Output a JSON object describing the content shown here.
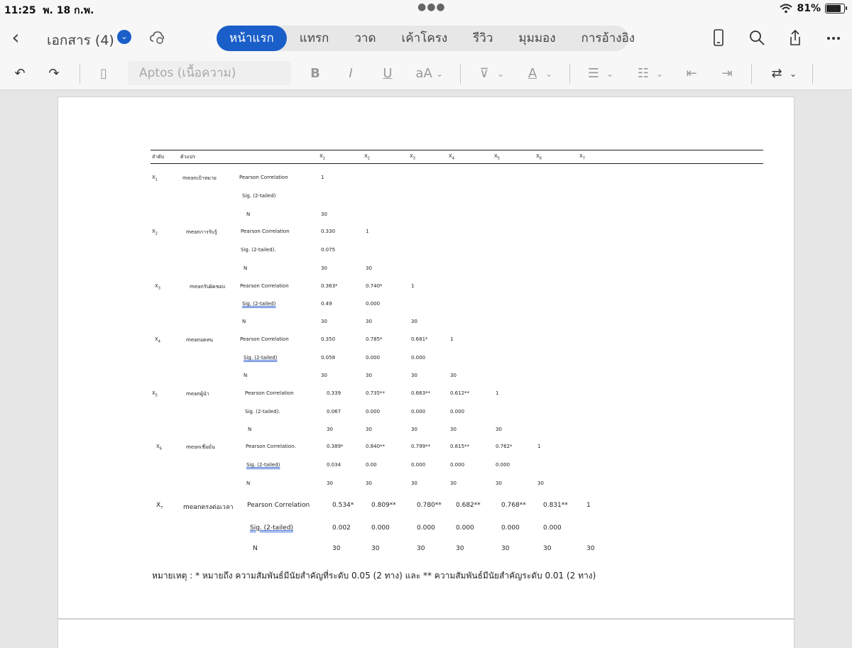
{
  "status": {
    "time": "11:25",
    "date": "พ. 18 ก.พ.",
    "battery": "81%"
  },
  "header": {
    "title": "เอกสาร (4)",
    "tabs": [
      "หน้าแรก",
      "แทรก",
      "วาด",
      "เค้าโครง",
      "รีวิว",
      "มุมมอง",
      "การอ้างอิง"
    ],
    "active_tab": 0
  },
  "toolbar": {
    "font_name": "Aptos (เนื้อความ)",
    "bold": "B",
    "italic": "I",
    "underline": "U",
    "font_size": "aA"
  },
  "table": {
    "headers": {
      "order": "ลำดับ",
      "variable": "ตัวแปร",
      "x1": "X",
      "x2": "X",
      "x3": "X",
      "x4": "X",
      "x5": "X",
      "x6": "X",
      "x7": "X"
    },
    "rows": [
      {
        "id": "X",
        "id_sub": "1",
        "name": "meanเป้าหมาย",
        "stats": [
          {
            "label": "Pearson Correlation",
            "values": [
              "1",
              "",
              "",
              "",
              "",
              "",
              ""
            ]
          },
          {
            "label": "Sig. (2-tailed)",
            "values": [
              "",
              "",
              "",
              "",
              "",
              "",
              ""
            ]
          },
          {
            "label": "N",
            "values": [
              "30",
              "",
              "",
              "",
              "",
              "",
              ""
            ]
          }
        ]
      },
      {
        "id": "X",
        "id_sub": "2",
        "name": "meanการรับรู้",
        "stats": [
          {
            "label": "Pearson Correlation",
            "values": [
              "0.330",
              "1",
              "",
              "",
              "",
              "",
              ""
            ]
          },
          {
            "label": "Sig. (2-tailed).",
            "values": [
              "0.075",
              "",
              "",
              "",
              "",
              "",
              ""
            ]
          },
          {
            "label": "N",
            "values": [
              "30",
              "30",
              "",
              "",
              "",
              "",
              ""
            ]
          }
        ]
      },
      {
        "id": "X",
        "id_sub": "3",
        "name": "meanรับผิดชอบ",
        "stats": [
          {
            "label": "Pearson Correlation",
            "values": [
              "0.363*",
              "0.740*",
              "1",
              "",
              "",
              "",
              ""
            ]
          },
          {
            "label": "Sig. (2-tailed)",
            "values": [
              "0.49",
              "0.000",
              "",
              "",
              "",
              "",
              ""
            ]
          },
          {
            "label": "N",
            "values": [
              "30",
              "30",
              "30",
              "",
              "",
              "",
              ""
            ]
          }
        ]
      },
      {
        "id": "X",
        "id_sub": "4",
        "name": "meanอดทน",
        "stats": [
          {
            "label": "Pearson Correlation",
            "values": [
              "0.350",
              "0.785*",
              "0.681*",
              "1",
              "",
              "",
              ""
            ]
          },
          {
            "label": "Sig. (2-tailed)",
            "values": [
              "0.058",
              "0.000",
              "0.000",
              "",
              "",
              "",
              ""
            ]
          },
          {
            "label": "N",
            "values": [
              "30",
              "30",
              "30",
              "30",
              "",
              "",
              ""
            ]
          }
        ]
      },
      {
        "id": "X",
        "id_sub": "5",
        "name": "meanผู้นำ",
        "stats": [
          {
            "label": "Pearson Correlation",
            "values": [
              "0.339",
              "0.735**",
              "0.663**",
              "0.612**",
              "1",
              "",
              ""
            ]
          },
          {
            "label": "Sig. (2-tailed).",
            "values": [
              "0.067",
              "0.000",
              "0.000",
              "0.000",
              "",
              "",
              ""
            ]
          },
          {
            "label": "N",
            "values": [
              "30",
              "30",
              "30",
              "30",
              "30",
              "",
              ""
            ]
          }
        ]
      },
      {
        "id": "X",
        "id_sub": "6",
        "name": "meanเชื่อมั่น",
        "stats": [
          {
            "label": "Pearson Correlation.",
            "values": [
              "0.389*",
              "0.840**",
              "0.799**",
              "0.815**",
              "0.762*",
              "1",
              ""
            ]
          },
          {
            "label": "Sig. (2-tailed)",
            "values": [
              "0.034",
              "0.00",
              "0.000",
              "0.000",
              "0.000",
              "",
              ""
            ]
          },
          {
            "label": "N",
            "values": [
              "30",
              "30",
              "30",
              "30",
              "30",
              "30",
              ""
            ]
          }
        ]
      },
      {
        "id": "X",
        "id_sub": "7",
        "name": "meanตรงต่อเวลา",
        "stats": [
          {
            "label": "Pearson Correlation",
            "values": [
              "0.534*",
              "0.809**",
              "0.780**",
              "0.682**",
              "0.768**",
              "0.831**",
              "1"
            ]
          },
          {
            "label": "Sig. (2-tailed)",
            "values": [
              "0.002",
              "0.000",
              "0.000",
              "0.000",
              "0.000",
              "0.000",
              ""
            ]
          },
          {
            "label": "N",
            "values": [
              "30",
              "30",
              "30",
              "30",
              "30",
              "30",
              "30"
            ]
          }
        ]
      }
    ],
    "note": "หมายเหตุ : * หมายถึง ความสัมพันธ์มีนัยสำคัญที่ระดับ 0.05 (2 ทาง) และ ** ความสัมพันธ์มีนัยสำคัญระดับ 0.01 (2 ทาง)"
  }
}
